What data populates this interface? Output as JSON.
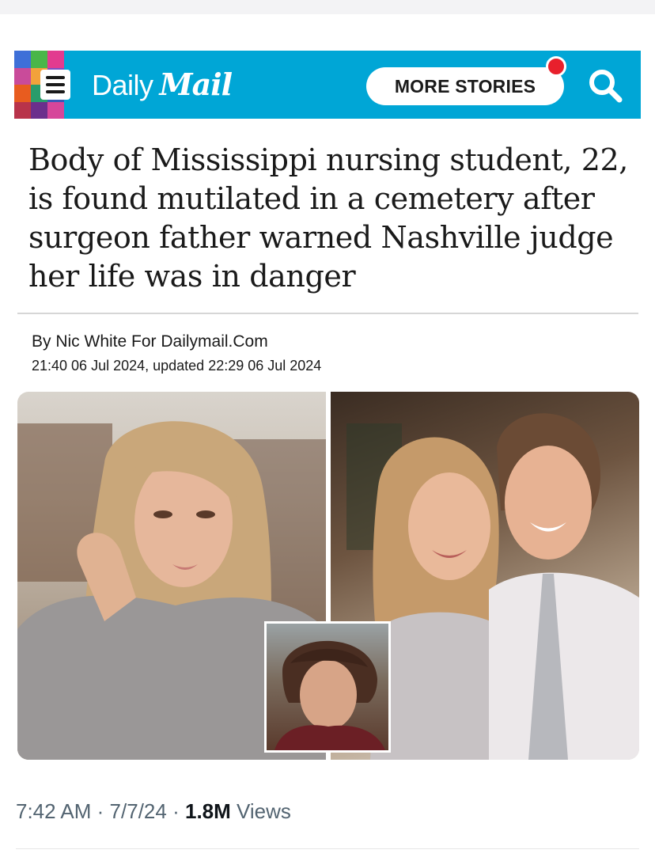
{
  "header": {
    "brand_daily": "Daily",
    "brand_mail": "Mail",
    "more_stories_label": "MORE STORIES",
    "bar_color": "#00a6d6",
    "notification_color": "#e8202c",
    "icons": [
      "menu-icon",
      "search-icon"
    ]
  },
  "article": {
    "headline": "Body of Mississippi nursing student, 22, is found mutilated in a cemetery after surgeon father warned Nashville judge her life was in danger",
    "byline": "By Nic White For Dailymail.Com",
    "dateline": "21:40 06 Jul 2024, updated 22:29 06 Jul 2024"
  },
  "post_meta": {
    "time": "7:42 AM",
    "date": "7/7/24",
    "views_count": "1.8M",
    "views_label": "Views",
    "separator": "·"
  }
}
